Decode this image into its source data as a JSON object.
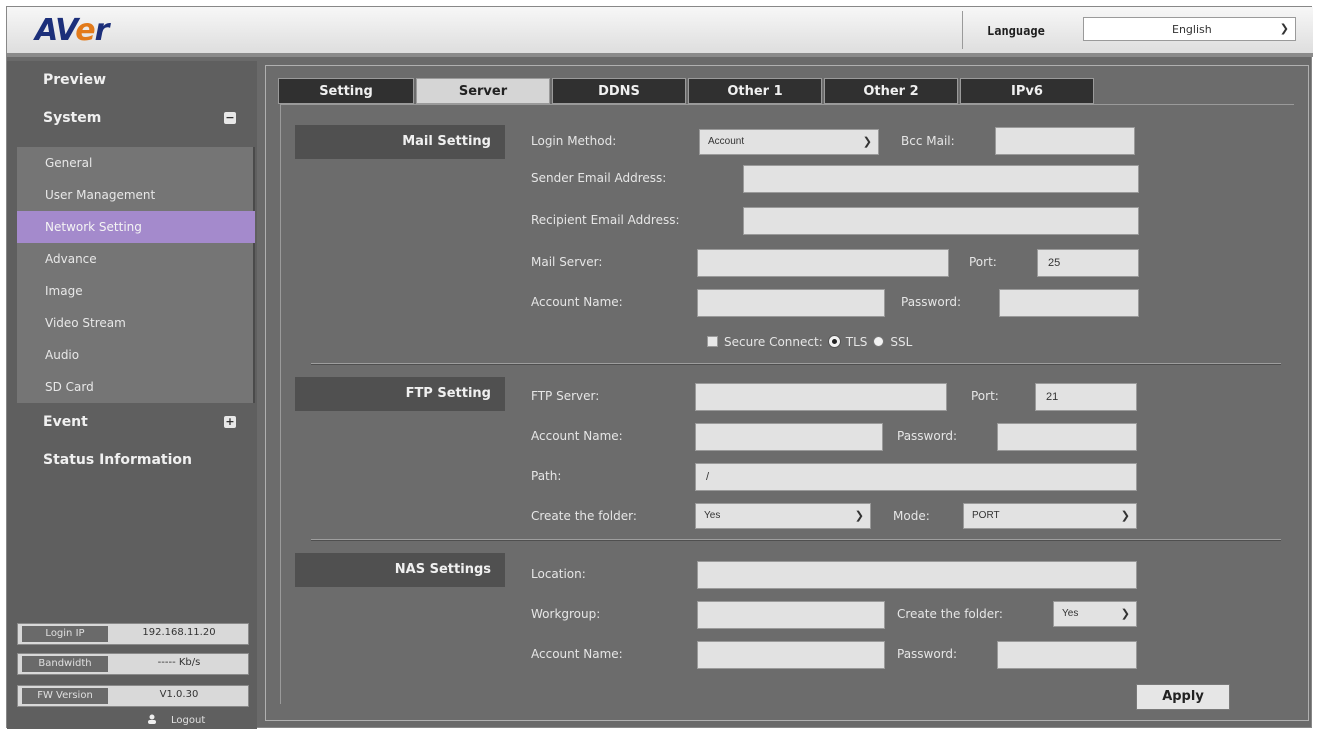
{
  "header": {
    "logo_main": "AV",
    "logo_accent": "e",
    "logo_tail": "r",
    "language_label": "Language",
    "language_value": "English"
  },
  "sidebar": {
    "preview": "Preview",
    "system": "System",
    "system_items": [
      "General",
      "User Management",
      "Network Setting",
      "Advance",
      "Image",
      "Video Stream",
      "Audio",
      "SD Card"
    ],
    "active_item": "Network Setting",
    "event": "Event",
    "status_information": "Status Information",
    "info": [
      {
        "key": "Login IP",
        "value": "192.168.11.20"
      },
      {
        "key": "Bandwidth",
        "value": "----- Kb/s"
      },
      {
        "key": "FW Version",
        "value": "V1.0.30"
      }
    ],
    "logout": "Logout"
  },
  "tabs": [
    "Setting",
    "Server",
    "DDNS",
    "Other 1",
    "Other 2",
    "IPv6"
  ],
  "active_tab": "Server",
  "mail": {
    "title": "Mail Setting",
    "login_method_label": "Login Method:",
    "login_method_value": "Account",
    "bcc_label": "Bcc Mail:",
    "bcc_value": "",
    "sender_label": "Sender Email Address:",
    "sender_value": "",
    "recipient_label": "Recipient Email Address:",
    "recipient_value": "",
    "server_label": "Mail Server:",
    "server_value": "",
    "port_label": "Port:",
    "port_value": "25",
    "account_label": "Account Name:",
    "account_value": "",
    "password_label": "Password:",
    "password_value": "",
    "secure_label": "Secure Connect:",
    "tls_label": "TLS",
    "ssl_label": "SSL"
  },
  "ftp": {
    "title": "FTP Setting",
    "server_label": "FTP Server:",
    "server_value": "",
    "port_label": "Port:",
    "port_value": "21",
    "account_label": "Account Name:",
    "account_value": "",
    "password_label": "Password:",
    "password_value": "",
    "path_label": "Path:",
    "path_value": "/",
    "create_folder_label": "Create the folder:",
    "create_folder_value": "Yes",
    "mode_label": "Mode:",
    "mode_value": "PORT"
  },
  "nas": {
    "title": "NAS Settings",
    "location_label": "Location:",
    "location_value": "",
    "workgroup_label": "Workgroup:",
    "workgroup_value": "",
    "create_folder_label": "Create the folder:",
    "create_folder_value": "Yes",
    "account_label": "Account Name:",
    "account_value": "",
    "password_label": "Password:",
    "password_value": ""
  },
  "apply_label": "Apply",
  "colors": {
    "active_nav": "#a48acc",
    "logo_blue": "#1c2f7a",
    "logo_orange": "#e27a1a"
  }
}
